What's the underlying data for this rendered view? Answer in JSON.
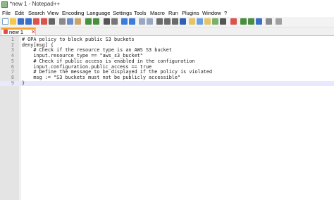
{
  "window": {
    "title": "*new 1 - Notepad++"
  },
  "menu": [
    "File",
    "Edit",
    "Search",
    "View",
    "Encoding",
    "Language",
    "Settings",
    "Tools",
    "Macro",
    "Run",
    "Plugins",
    "Window",
    "?"
  ],
  "tab": {
    "label": "new 1",
    "close": "✕"
  },
  "editor": {
    "lines": [
      {
        "num": "1",
        "text": "# OPA policy to block public S3 buckets"
      },
      {
        "num": "2",
        "text": "deny[msg] {"
      },
      {
        "num": "3",
        "text": "    # Check if the resource type is an AWS S3 bucket"
      },
      {
        "num": "4",
        "text": "    input.resource_type == \"aws_s3_bucket\""
      },
      {
        "num": "5",
        "text": "    # Check if public access is enabled in the configuration"
      },
      {
        "num": "6",
        "text": "    input.configuration.public_access == true"
      },
      {
        "num": "7",
        "text": "    # Define the message to be displayed if the policy is violated"
      },
      {
        "num": "8",
        "text": "    msg := \"S3 buckets must not be publicly accessible\""
      },
      {
        "num": "9",
        "text": "}"
      }
    ]
  }
}
